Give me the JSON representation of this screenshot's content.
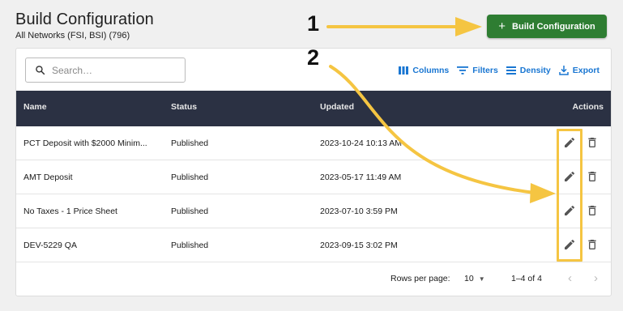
{
  "header": {
    "title": "Build Configuration",
    "subtitle": "All Networks (FSI, BSI) (796)",
    "primary_button_label": "Build Configuration",
    "primary_button_icon": "plus-icon",
    "primary_button_color": "#2e7d32"
  },
  "search": {
    "placeholder": "Search…"
  },
  "toolbar": {
    "columns_label": "Columns",
    "filters_label": "Filters",
    "density_label": "Density",
    "export_label": "Export",
    "accent_color": "#1976d2"
  },
  "table": {
    "columns": [
      "Name",
      "Status",
      "Updated",
      "Actions"
    ],
    "header_color": "#2b3143",
    "rows": [
      {
        "name": "PCT Deposit with $2000 Minim...",
        "status": "Published",
        "updated": "2023-10-24 10:13 AM"
      },
      {
        "name": "AMT Deposit",
        "status": "Published",
        "updated": "2023-05-17 11:49 AM"
      },
      {
        "name": "No Taxes - 1 Price Sheet",
        "status": "Published",
        "updated": "2023-07-10 3:59 PM"
      },
      {
        "name": "DEV-5229 QA",
        "status": "Published",
        "updated": "2023-09-15 3:02 PM"
      }
    ]
  },
  "pagination": {
    "rows_per_page_label": "Rows per page:",
    "rows_per_page_value": "10",
    "range_label": "1–4 of 4"
  },
  "annotations": {
    "step1": "1",
    "step2": "2",
    "color": "#f5c542"
  }
}
